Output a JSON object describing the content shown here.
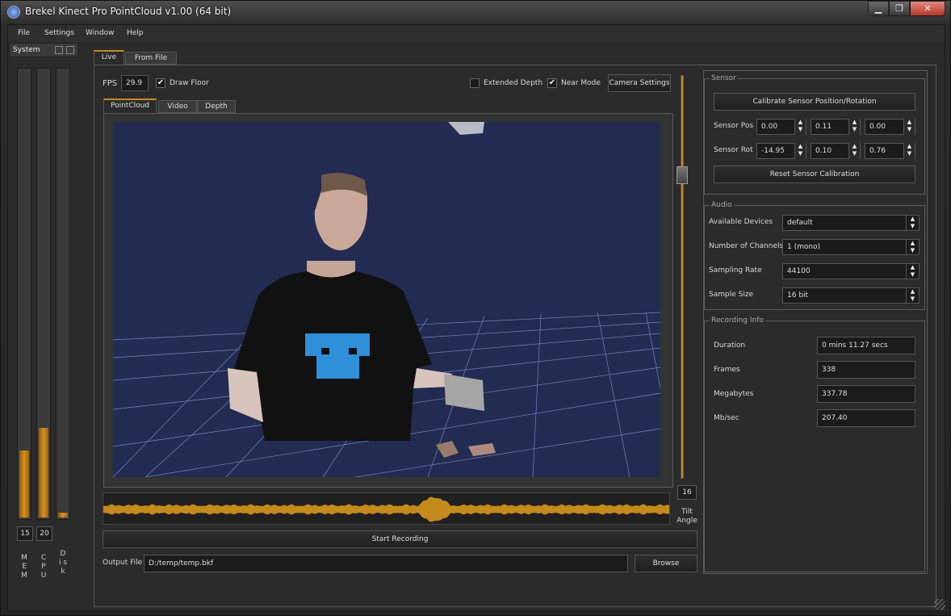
{
  "window": {
    "title": "Brekel Kinect Pro PointCloud v1.00 (64 bit)"
  },
  "menu": [
    "File",
    "Settings",
    "Window",
    "Help"
  ],
  "system": {
    "title": "System",
    "meters": [
      {
        "name": "MEM",
        "label": "M E M",
        "value": "15",
        "level": 0.15
      },
      {
        "name": "CPU",
        "label": "C P U",
        "value": "20",
        "level": 0.2
      },
      {
        "name": "Disk",
        "label": "D i s k",
        "value": "",
        "level": 0.01
      }
    ]
  },
  "tabs": {
    "live": "Live",
    "from_file": "From File"
  },
  "toolbar": {
    "fps_label": "FPS",
    "fps_value": "29.9",
    "draw_floor": "Draw Floor",
    "extended_depth": "Extended Depth",
    "near_mode": "Near Mode",
    "camera_settings": "Camera Settings",
    "check_mark": "✔"
  },
  "view_tabs": [
    "PointCloud",
    "Video",
    "Depth"
  ],
  "tilt": {
    "value": "16",
    "label": "Tilt\nAngle",
    "level": 0.16
  },
  "start_recording": "Start Recording",
  "output": {
    "label": "Output File",
    "value": "D:/temp/temp.bkf",
    "browse": "Browse"
  },
  "sensor": {
    "title": "Sensor",
    "calibrate": "Calibrate Sensor Position/Rotation",
    "pos_label": "Sensor Pos",
    "pos": [
      "0.00",
      "0.11",
      "0.00"
    ],
    "rot_label": "Sensor Rot",
    "rot": [
      "-14.95",
      "0.10",
      "0.76"
    ],
    "reset": "Reset Sensor Calibration"
  },
  "audio": {
    "title": "Audio",
    "rows": [
      {
        "label": "Available Devices",
        "value": "default"
      },
      {
        "label": "Number of Channels",
        "value": "1 (mono)"
      },
      {
        "label": "Sampling Rate",
        "value": "44100"
      },
      {
        "label": "Sample Size",
        "value": "16 bit"
      }
    ]
  },
  "recording_info": {
    "title": "Recording Info",
    "rows": [
      {
        "label": "Duration",
        "value": "0 mins 11.27 secs"
      },
      {
        "label": "Frames",
        "value": "338"
      },
      {
        "label": "Megabytes",
        "value": "337.78"
      },
      {
        "label": "Mb/sec",
        "value": "207.40"
      }
    ]
  },
  "colors": {
    "accent": "#c98a1c",
    "viewport_bg": "#222b52",
    "grid": "#8fa0d8"
  }
}
